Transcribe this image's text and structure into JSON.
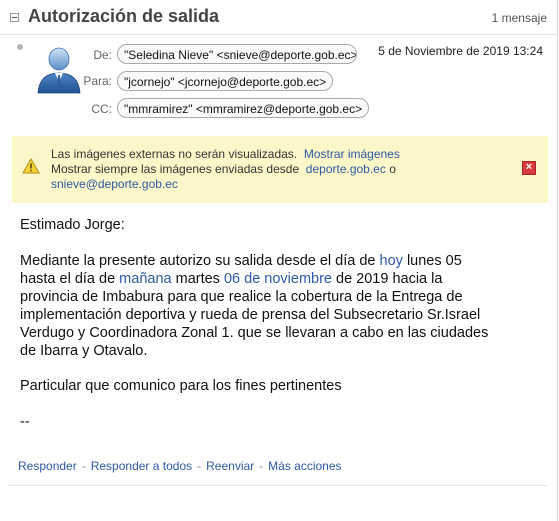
{
  "header": {
    "subject": "Autorización de salida",
    "message_count": "1 mensaje"
  },
  "sender": {
    "from_label": "De:",
    "from_value": "\"Seledina Nieve\" <snieve@deporte.gob.ec>",
    "to_label": "Para:",
    "to_value": "\"jcornejo\" <jcornejo@deporte.gob.ec>",
    "cc_label": "CC:",
    "cc_value": "\"mmramirez\" <mmramirez@deporte.gob.ec>",
    "date": "5 de Noviembre de 2019 13:24"
  },
  "notice": {
    "text_1": "Las imágenes externas no serán visualizadas.",
    "show_images": "Mostrar imágenes",
    "text_2": "Mostrar siempre las imágenes enviadas desde",
    "domain_link": "deporte.gob.ec",
    "or": "o",
    "email_link": "snieve@deporte.gob.ec"
  },
  "body": {
    "greeting": "Estimado Jorge:",
    "p1_l1_a": "Mediante la presente autorizo su salida desde el día de",
    "p1_l1_link": "hoy",
    "p1_l1_b": "lunes 05",
    "p1_l2_a": "hasta el día de",
    "p1_l2_link1": "mañana",
    "p1_l2_b": "martes",
    "p1_l2_link2": "06 de noviembre",
    "p1_l2_c": "de 2019 hacia la",
    "p1_l3": "provincia de Imbabura para que realice la cobertura de la Entrega de",
    "p1_l4": "implementación deportiva y  rueda de prensa del Subsecretario Sr.Israel",
    "p1_l5": "Verdugo y Coordinadora Zonal 1. que se llevaran a cabo en las ciudades",
    "p1_l6": "de Ibarra y Otavalo.",
    "closing": "Particular que comunico para los fines pertinentes",
    "signature": "--"
  },
  "actions": {
    "reply": "Responder",
    "reply_all": "Responder a todos",
    "forward": "Reenviar",
    "more": "Más acciones",
    "separator": "-"
  },
  "colors": {
    "link": "#2d59a5",
    "notice_bg": "#fbf7c8",
    "close_red": "#d53b3b"
  }
}
